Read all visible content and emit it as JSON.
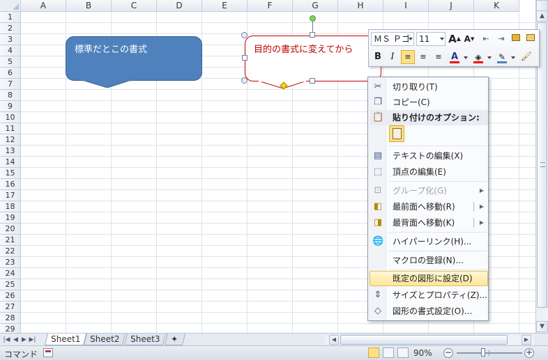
{
  "grid": {
    "columns": [
      "A",
      "B",
      "C",
      "D",
      "E",
      "F",
      "G",
      "H",
      "I",
      "J",
      "K"
    ],
    "rows": [
      "1",
      "2",
      "3",
      "4",
      "5",
      "6",
      "7",
      "8",
      "9",
      "10",
      "11",
      "12",
      "13",
      "14",
      "15",
      "16",
      "17",
      "18",
      "19",
      "20",
      "21",
      "22",
      "23",
      "24",
      "25",
      "26",
      "27",
      "28",
      "29"
    ]
  },
  "shapes": {
    "shape1_text": "標準だとこの書式",
    "shape1_fill": "#4f81bd",
    "shape2_text": "目的の書式に変えてから",
    "shape2_line": "#c00000"
  },
  "mini_toolbar": {
    "font_name": "ＭＳ Ｐゴ",
    "font_size": "11",
    "grow_font": "A",
    "shrink_font": "A",
    "bold": "B",
    "italic": "I",
    "font_color_letter": "A"
  },
  "context_menu": {
    "items": [
      {
        "label": "切り取り(T)",
        "icon": "scissors-icon"
      },
      {
        "label": "コピー(C)",
        "icon": "copy-icon"
      },
      {
        "label": "貼り付けのオプション:",
        "icon": "paste-icon"
      },
      {
        "label": "テキストの編集(X)",
        "icon": "edit-text-icon"
      },
      {
        "label": "頂点の編集(E)",
        "icon": "edit-points-icon"
      },
      {
        "label": "グループ化(G)",
        "icon": "group-icon"
      },
      {
        "label": "最前面へ移動(R)",
        "icon": "bring-front-icon"
      },
      {
        "label": "最背面へ移動(K)",
        "icon": "send-back-icon"
      },
      {
        "label": "ハイパーリンク(H)...",
        "icon": "hyperlink-icon"
      },
      {
        "label": "マクロの登録(N)...",
        "icon": ""
      },
      {
        "label": "既定の図形に設定(D)",
        "icon": ""
      },
      {
        "label": "サイズとプロパティ(Z)...",
        "icon": "size-icon"
      },
      {
        "label": "図形の書式設定(O)...",
        "icon": "format-shape-icon"
      }
    ]
  },
  "sheet_tabs": [
    "Sheet1",
    "Sheet2",
    "Sheet3"
  ],
  "status_bar": {
    "mode": "コマンド",
    "zoom": "90%",
    "zoom_minus": "−",
    "zoom_plus": "+"
  },
  "colors": {
    "highlight": "#fbe08a",
    "header_bg": "#e9eef5"
  }
}
